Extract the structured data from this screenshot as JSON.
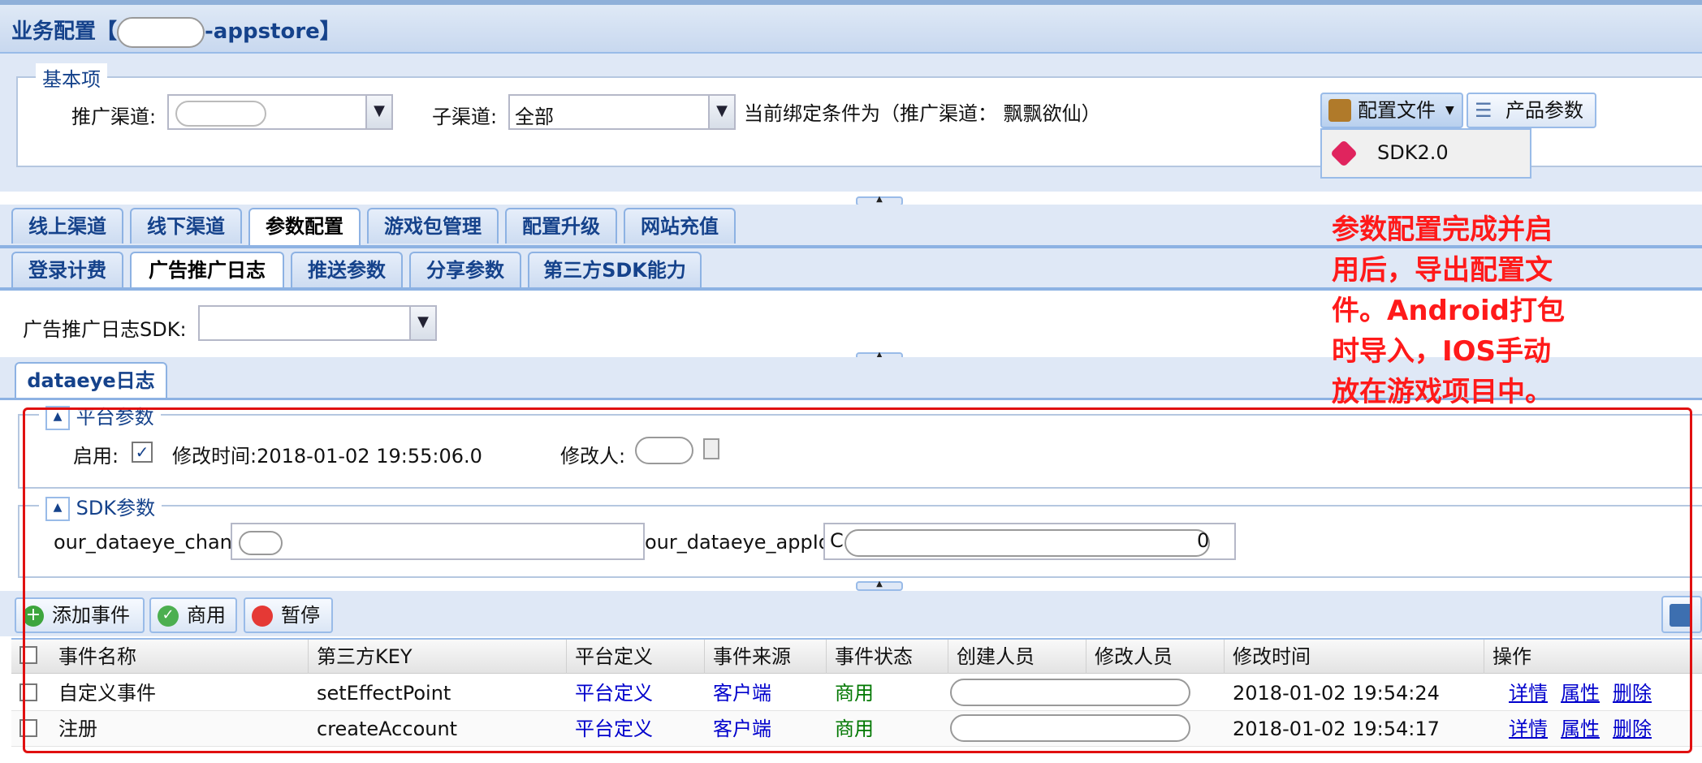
{
  "title": {
    "prefix": "业务配置【",
    "suffix": "-appstore】"
  },
  "basic": {
    "legend": "基本项",
    "channel_label": "推广渠道:",
    "subchannel_label": "子渠道:",
    "subchannel_value": "全部",
    "binding_text": "当前绑定条件为（推广渠道： 飘飘欲仙）",
    "config_button": "配置文件",
    "product_button": "产品参数",
    "menu_item": "SDK2.0"
  },
  "tabs_top": [
    "线上渠道",
    "线下渠道",
    "参数配置",
    "游戏包管理",
    "配置升级",
    "网站充值"
  ],
  "tabs_sub": [
    "登录计费",
    "广告推广日志",
    "推送参数",
    "分享参数",
    "第三方SDK能力"
  ],
  "sdk_label": "广告推广日志SDK:",
  "inner_tab": "dataeye日志",
  "platform": {
    "legend": "平台参数",
    "enabled_label": "启用:",
    "modified_time": "修改时间:2018-01-02 19:55:06.0",
    "modifier_label": "修改人:"
  },
  "sdk_params": {
    "legend": "SDK参数",
    "field1_label": "our_dataeye_chann",
    "field2_label": "our_dataeye_appId:",
    "field2_prefix": "C",
    "field2_suffix": "0"
  },
  "toolbar": {
    "add": "添加事件",
    "commercial": "商用",
    "pause": "暂停"
  },
  "table": {
    "headers": [
      "事件名称",
      "第三方KEY",
      "平台定义",
      "事件来源",
      "事件状态",
      "创建人员",
      "修改人员",
      "修改时间",
      "操作"
    ],
    "rows": [
      {
        "name": "自定义事件",
        "key": "setEffectPoint",
        "platform": "平台定义",
        "source": "客户端",
        "status": "商用",
        "time": "2018-01-02 19:54:24",
        "a1": "详情",
        "a2": "属性",
        "a3": "删除"
      },
      {
        "name": "注册",
        "key": "createAccount",
        "platform": "平台定义",
        "source": "客户端",
        "status": "商用",
        "time": "2018-01-02 19:54:17",
        "a1": "详情",
        "a2": "属性",
        "a3": "删除"
      }
    ]
  },
  "annotation": [
    "参数配置完成并启",
    "用后，导出配置文",
    "件。Android打包",
    "时导入，IOS手动",
    "放在游戏项目中。"
  ]
}
